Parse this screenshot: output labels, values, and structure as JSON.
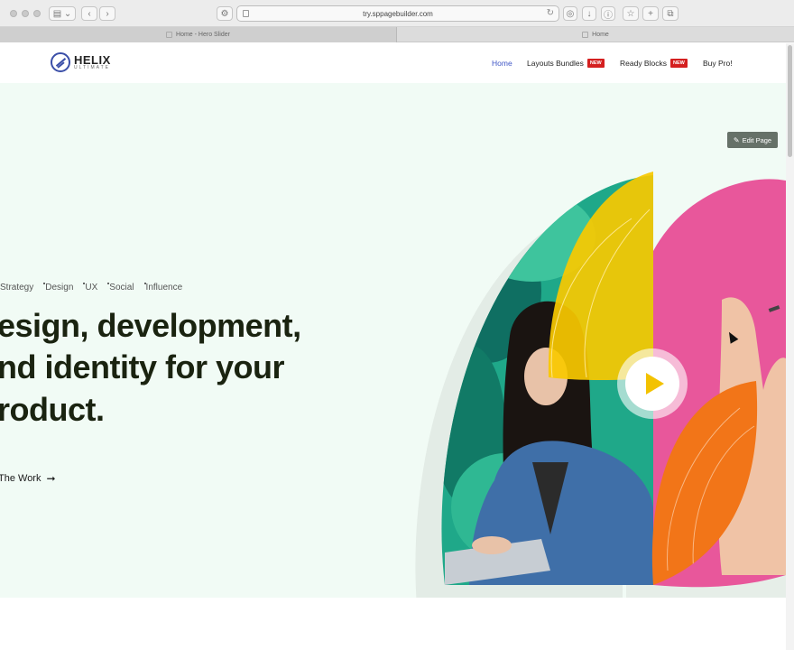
{
  "browser": {
    "url": "try.sppagebuilder.com",
    "tabs": [
      {
        "title": "Home - Hero Slider",
        "active": true
      },
      {
        "title": "Home",
        "active": false
      }
    ]
  },
  "header": {
    "logo": {
      "name": "HELIX",
      "tagline": "ULTIMATE"
    },
    "nav": [
      {
        "label": "Home",
        "active": true
      },
      {
        "label": "Layouts Bundles",
        "badge": "NEW"
      },
      {
        "label": "Ready Blocks",
        "badge": "NEW"
      },
      {
        "label": "Buy Pro!"
      }
    ]
  },
  "hero": {
    "edit_label": "Edit Page",
    "tags": [
      "Strategy",
      "Design",
      "UX",
      "Social",
      "Influence"
    ],
    "headline": [
      "esign, development,",
      "nd identity for your",
      "roduct."
    ],
    "cta_label": "The Work"
  },
  "colors": {
    "accent": "#3f56c6",
    "badge": "#d41f1f",
    "hero_bg": "#f1fbf5",
    "headline": "#1a2310",
    "yellow": "#f8c900",
    "orange": "#f27518",
    "pink": "#e8579b",
    "teal": "#20a98b"
  },
  "icons": {
    "edit": "pencil-square-icon",
    "cta_arrow": "arrow-right-icon",
    "play": "play-icon"
  }
}
